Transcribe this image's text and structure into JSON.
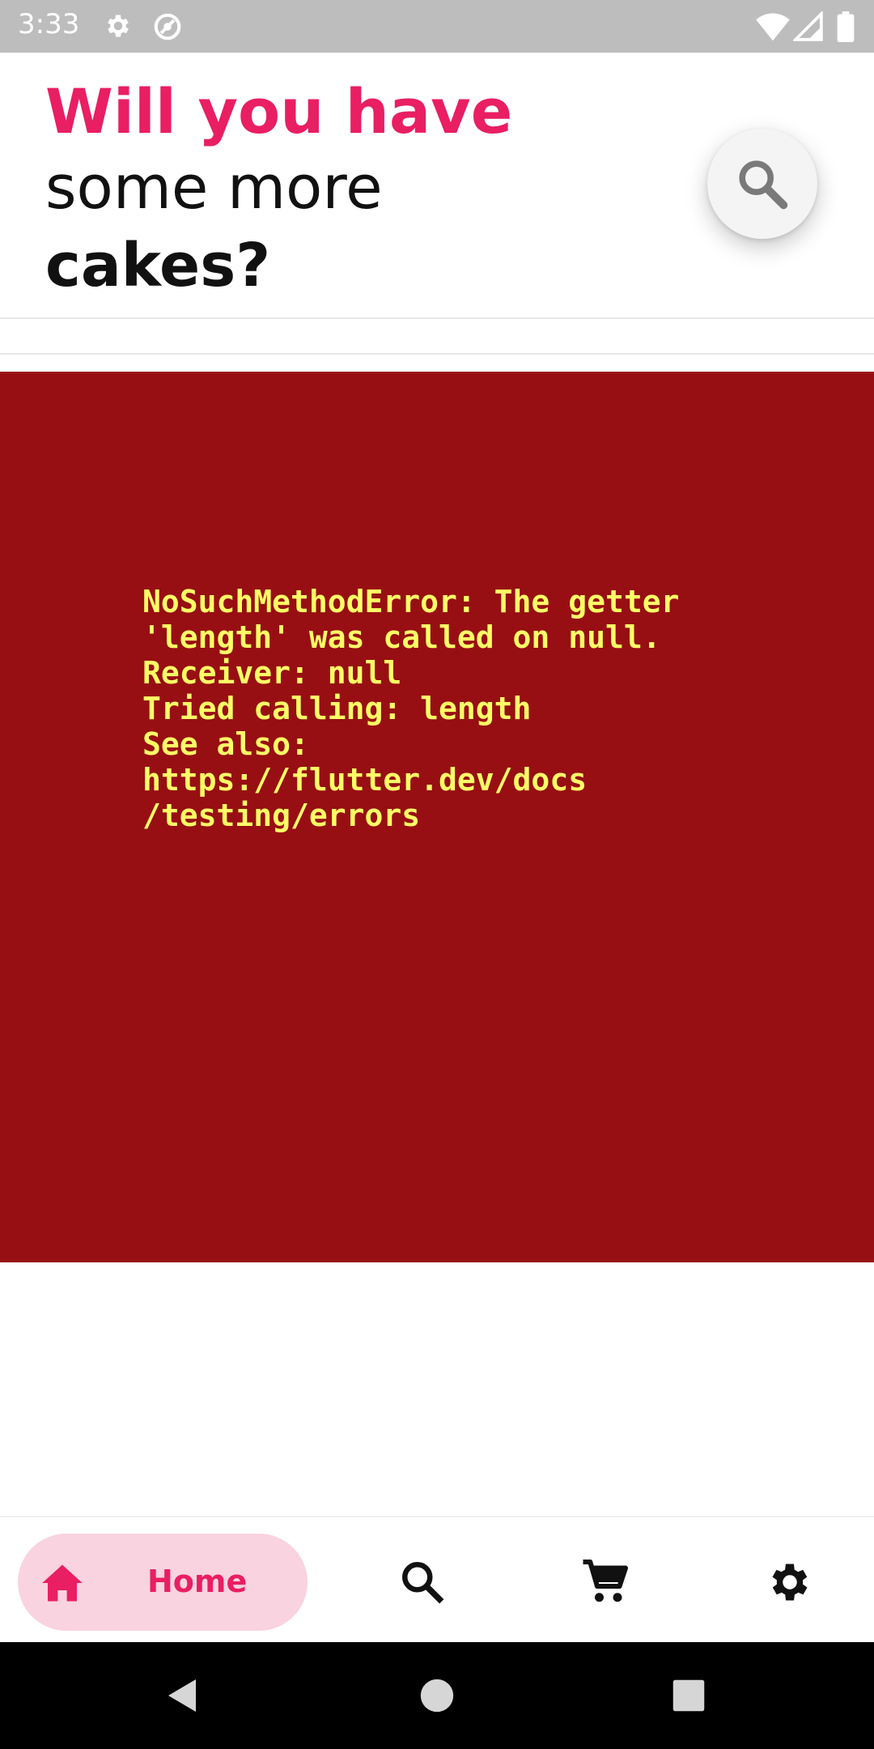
{
  "status_bar": {
    "time": "3:33",
    "icons": [
      "gear-icon",
      "sync-icon",
      "wifi-icon",
      "signal-icon",
      "battery-icon"
    ]
  },
  "header": {
    "title_line1": "Will you have",
    "title_line2": "some more",
    "title_line3": "cakes?",
    "search_button_icon": "search-icon",
    "accent_color": "#e91e63"
  },
  "error": {
    "message": "NoSuchMethodError: The getter\n'length' was called on null.\nReceiver: null\nTried calling: length\nSee also:\nhttps://flutter.dev/docs\n/testing/errors",
    "background_color": "#970f12",
    "text_color": "#ffff66"
  },
  "bottom_nav": {
    "items": [
      {
        "label": "Home",
        "icon": "home-icon",
        "selected": true
      },
      {
        "label": "",
        "icon": "search-icon",
        "selected": false
      },
      {
        "label": "",
        "icon": "cart-icon",
        "selected": false
      },
      {
        "label": "",
        "icon": "settings-icon",
        "selected": false
      }
    ],
    "selected_bg": "#f9d3df"
  },
  "system_nav": {
    "icons": [
      "back-icon",
      "home-circle-icon",
      "recents-icon"
    ]
  }
}
